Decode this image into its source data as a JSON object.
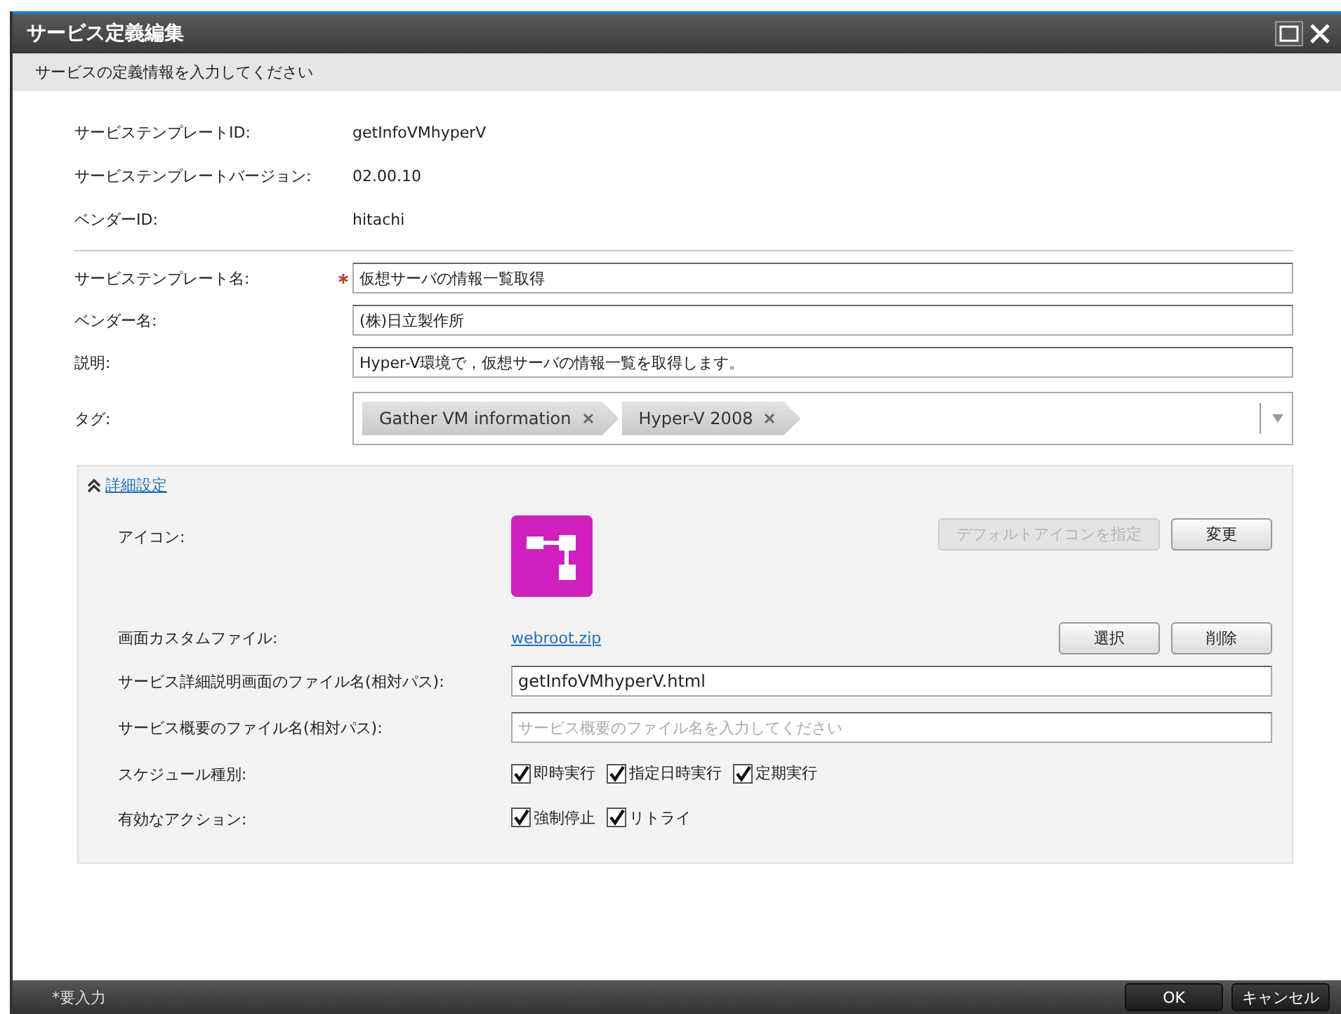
{
  "window": {
    "title": "サービス定義編集",
    "subtitle": "サービスの定義情報を入力してください"
  },
  "info": [
    {
      "label": "サービステンプレートID:",
      "value": "getInfoVMhyperV"
    },
    {
      "label": "サービステンプレートバージョン:",
      "value": "02.00.10"
    },
    {
      "label": "ベンダーID:",
      "value": "hitachi"
    }
  ],
  "fields": [
    {
      "label": "サービステンプレート名:",
      "required": true,
      "value": "仮想サーバの情報一覧取得"
    },
    {
      "label": "ベンダー名:",
      "required": false,
      "value": "(株)日立製作所"
    },
    {
      "label": "説明:",
      "required": false,
      "value": "Hyper-V環境で，仮想サーバの情報一覧を取得します。"
    }
  ],
  "tags": {
    "label": "タグ:",
    "items": [
      "Gather VM information",
      "Hyper-V 2008"
    ]
  },
  "advanced": {
    "label": "詳細設定",
    "expanded": true,
    "icon_row": {
      "label": "アイコン:",
      "buttons": [
        {
          "label": "デフォルトアイコンを指定",
          "disabled": true
        },
        {
          "label": "変更",
          "disabled": false
        }
      ]
    },
    "custom_file": {
      "label": "画面カスタムファイル:",
      "link": "webroot.zip",
      "buttons": [
        {
          "label": "選択",
          "disabled": false
        },
        {
          "label": "削除",
          "disabled": false
        }
      ]
    },
    "detail_file": {
      "label": "サービス詳細説明画面のファイル名(相対パス):",
      "value": "getInfoVMhyperV.html"
    },
    "summary_file": {
      "label": "サービス概要のファイル名(相対パス):",
      "placeholder": "サービス概要のファイル名を入力してください"
    },
    "checks": [
      {
        "label": "スケジュール種別:",
        "options": [
          {
            "label": "即時実行",
            "checked": true
          },
          {
            "label": "指定日時実行",
            "checked": true
          },
          {
            "label": "定期実行",
            "checked": true
          }
        ]
      },
      {
        "label": "有効なアクション:",
        "options": [
          {
            "label": "強制停止",
            "checked": true
          },
          {
            "label": "リトライ",
            "checked": true
          }
        ]
      }
    ]
  },
  "footer": {
    "note": "*要入力",
    "buttons": [
      "OK",
      "キャンセル"
    ]
  }
}
